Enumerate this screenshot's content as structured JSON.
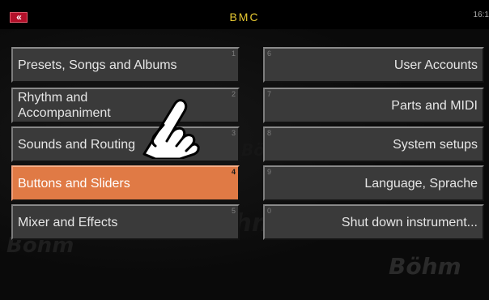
{
  "header": {
    "back_icon": "double-chevron-left-icon",
    "back_symbol": "«",
    "title": "BMC",
    "clock": "16:1"
  },
  "watermark": {
    "text": "Böhm"
  },
  "menu": {
    "left": [
      {
        "label": "Presets, Songs and Albums",
        "number": "1",
        "active": false
      },
      {
        "label": "Rhythm and Accompaniment",
        "number": "2",
        "active": false
      },
      {
        "label": "Sounds and Routing",
        "number": "3",
        "active": false
      },
      {
        "label": "Buttons and Sliders",
        "number": "4",
        "active": true
      },
      {
        "label": "Mixer and Effects",
        "number": "5",
        "active": false
      }
    ],
    "right": [
      {
        "label": "User Accounts",
        "number": "6"
      },
      {
        "label": "Parts and MIDI",
        "number": "7"
      },
      {
        "label": "System setups",
        "number": "8"
      },
      {
        "label": "Language, Sprache",
        "number": "9"
      },
      {
        "label": "Shut down instrument...",
        "number": "0"
      }
    ]
  },
  "pointer": {
    "icon": "pointing-hand-icon"
  },
  "colors": {
    "accent_active": "#e07a45",
    "title": "#e6c832",
    "back_button": "#b3102a"
  }
}
